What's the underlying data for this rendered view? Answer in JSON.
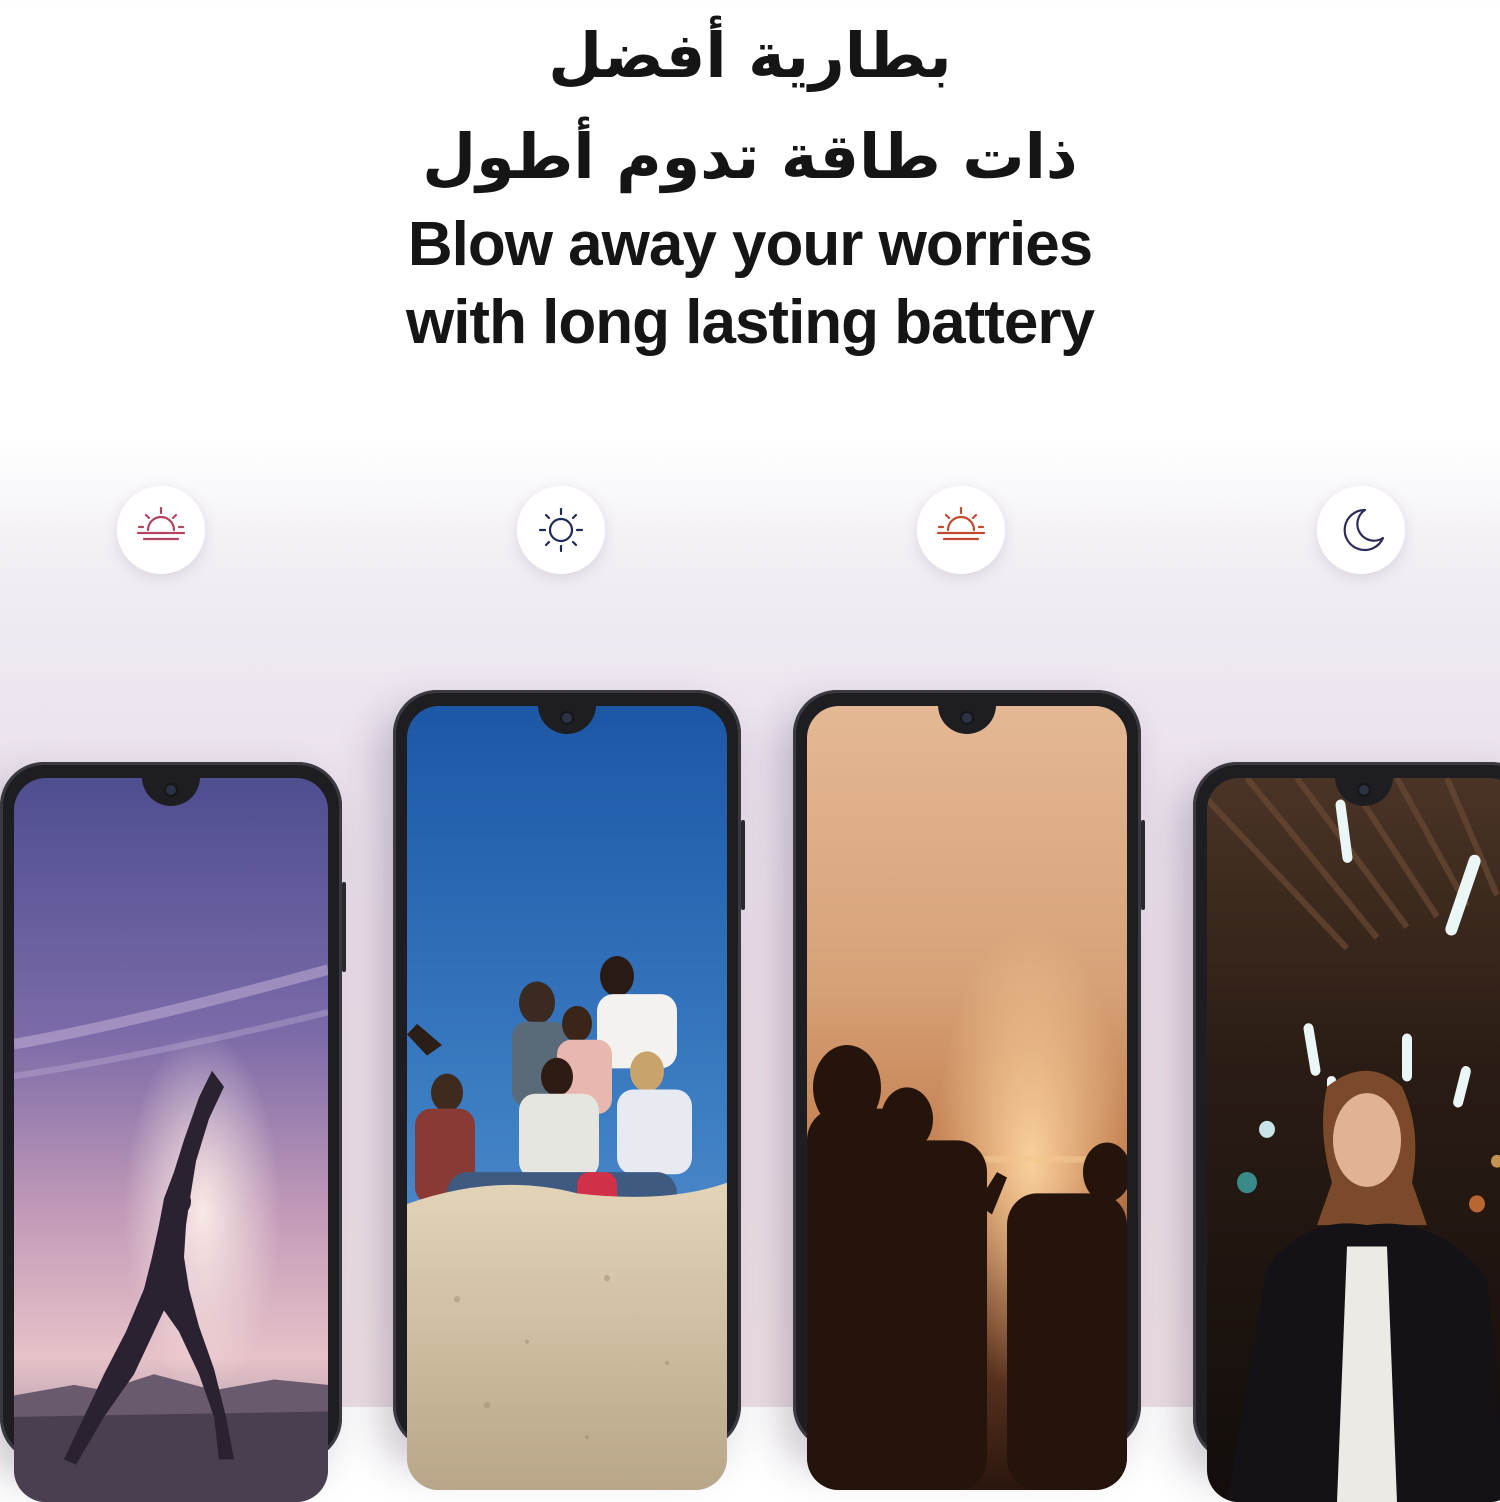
{
  "headline": {
    "arabic_line1": "بطارية أفضل",
    "arabic_line2": "ذات طاقة تدوم أطول",
    "english_line1": "Blow away your worries",
    "english_line2": "with long lasting battery"
  },
  "time_icons": [
    {
      "icon": "sunrise-icon",
      "color": "#b3445f"
    },
    {
      "icon": "sun-icon",
      "color": "#1f2a55"
    },
    {
      "icon": "sunset-icon",
      "color": "#c0492f"
    },
    {
      "icon": "moon-icon",
      "color": "#2c2a5a"
    }
  ],
  "phones": [
    {
      "scene": "yoga at dusk",
      "palette": [
        "#5d5a96",
        "#a88cb4",
        "#d8b0c0"
      ]
    },
    {
      "scene": "friends on rock under blue sky",
      "palette": [
        "#1d5aa8",
        "#4a86c8",
        "#d9c9ad"
      ]
    },
    {
      "scene": "sunset on beach",
      "palette": [
        "#d9a883",
        "#b9784c",
        "#3b2418"
      ]
    },
    {
      "scene": "night city lights",
      "palette": [
        "#2a1a12",
        "#6a4a32",
        "#111214"
      ]
    }
  ]
}
